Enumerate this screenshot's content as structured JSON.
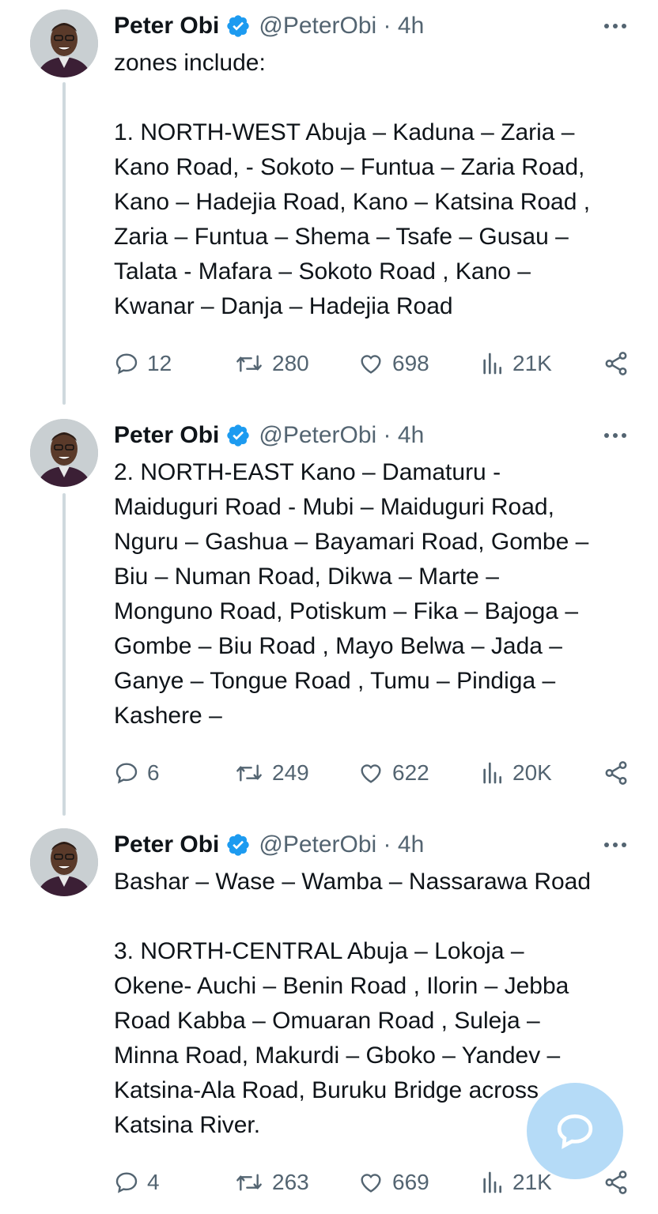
{
  "tweets": [
    {
      "name": "Peter Obi",
      "handle": "@PeterObi · 4h",
      "text": "zones include:\n\n1. NORTH-WEST Abuja – Kaduna – Zaria –\nKano Road, - Sokoto – Funtua – Zaria Road,\nKano – Hadejia Road, Kano – Katsina Road ,\nZaria – Funtua – Shema – Tsafe – Gusau –\nTalata - Mafara – Sokoto Road , Kano –\nKwanar – Danja – Hadejia Road",
      "replies": "12",
      "reposts": "280",
      "likes": "698",
      "views": "21K"
    },
    {
      "name": "Peter Obi",
      "handle": "@PeterObi · 4h",
      "text": "2. NORTH-EAST Kano – Damaturu -\nMaiduguri Road - Mubi – Maiduguri Road,\nNguru – Gashua – Bayamari Road, Gombe –\nBiu – Numan Road, Dikwa – Marte –\nMonguno Road, Potiskum – Fika – Bajoga –\nGombe – Biu Road , Mayo Belwa – Jada –\nGanye – Tongue Road , Tumu – Pindiga –\nKashere –",
      "replies": "6",
      "reposts": "249",
      "likes": "622",
      "views": "20K"
    },
    {
      "name": "Peter Obi",
      "handle": "@PeterObi · 4h",
      "text": "Bashar – Wase – Wamba – Nassarawa Road\n\n3. NORTH-CENTRAL Abuja – Lokoja –\nOkene- Auchi – Benin Road , Ilorin – Jebba\nRoad Kabba – Omuaran Road , Suleja –\nMinna Road, Makurdi – Gboko – Yandev –\nKatsina-Ala Road, Buruku Bridge across\nKatsina River.",
      "replies": "4",
      "reposts": "263",
      "likes": "669",
      "views": "21K"
    }
  ],
  "colors": {
    "verified": "#1d9bf0",
    "muted": "#536471",
    "thread_line": "#cfd9de",
    "fab": "#78bef0"
  },
  "icons": [
    "verified-badge-icon",
    "more-icon",
    "reply-icon",
    "repost-icon",
    "like-icon",
    "views-icon",
    "share-icon",
    "compose-icon"
  ]
}
